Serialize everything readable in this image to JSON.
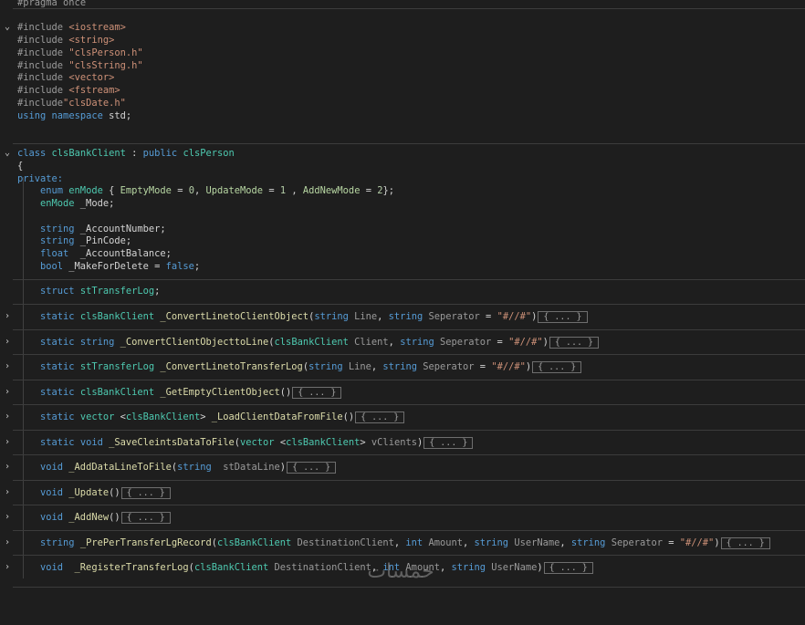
{
  "editor": {
    "lines": {
      "pragma": "#pragma once",
      "inc1_dir": "#include ",
      "inc1_file": "<iostream>",
      "inc2_dir": "#include ",
      "inc2_file": "<string>",
      "inc3_dir": "#include ",
      "inc3_file": "\"clsPerson.h\"",
      "inc4_dir": "#include ",
      "inc4_file": "\"clsString.h\"",
      "inc5_dir": "#include ",
      "inc5_file": "<vector>",
      "inc6_dir": "#include ",
      "inc6_file": "<fstream>",
      "inc7_dir": "#include",
      "inc7_file": "\"clsDate.h\"",
      "using_kw1": "using",
      "using_kw2": "namespace",
      "using_std": " std;",
      "class_kw": "class",
      "class_name": "clsBankClient",
      "class_sep": " : ",
      "class_pub": "public",
      "class_base": "clsPerson",
      "brace_open": "{",
      "private_kw": "private:",
      "enum_kw": "enum",
      "enum_name": "enMode",
      "enum_ob": " { ",
      "enum_v1": "EmptyMode",
      "enum_eq1": " = ",
      "enum_n1": "0",
      "enum_c1": ", ",
      "enum_v2": "UpdateMode",
      "enum_eq2": " = ",
      "enum_n2": "1",
      "enum_c2": " , ",
      "enum_v3": "AddNewMode",
      "enum_eq3": " = ",
      "enum_n3": "2",
      "enum_cb": "};",
      "mode_type": "enMode",
      "mode_var": " _Mode;",
      "acc_type": "string",
      "acc_var": " _AccountNumber;",
      "pin_type": "string",
      "pin_var": " _PinCode;",
      "bal_type": "float",
      "bal_var": "  _AccountBalance;",
      "del_type": "bool",
      "del_var": " _MakeForDelete = ",
      "del_val": "false",
      "del_end": ";",
      "struct_kw": "struct",
      "struct_name": "stTransferLog",
      "struct_end": ";",
      "f1_kw": "static",
      "f1_ret": "clsBankClient",
      "f1_name": "_ConvertLinetoClientObject",
      "f1_a": "(",
      "f1_t1": "string",
      "f1_p1": " Line",
      "f1_cm": ", ",
      "f1_t2": "string",
      "f1_p2": " Seperator",
      "f1_eq": " = ",
      "f1_def": "\"#//#\"",
      "f1_z": ")",
      "f2_kw": "static",
      "f2_ret": "string",
      "f2_name": "_ConvertClientObjecttoLine",
      "f2_a": "(",
      "f2_t1": "clsBankClient",
      "f2_p1": " Client",
      "f2_cm": ", ",
      "f2_t2": "string",
      "f2_p2": " Seperator",
      "f2_eq": " = ",
      "f2_def": "\"#//#\"",
      "f2_z": ")",
      "f3_kw": "static",
      "f3_ret": "stTransferLog",
      "f3_name": "_ConvertLinetoTransferLog",
      "f3_a": "(",
      "f3_t1": "string",
      "f3_p1": " Line",
      "f3_cm": ", ",
      "f3_t2": "string",
      "f3_p2": " Seperator",
      "f3_eq": " = ",
      "f3_def": "\"#//#\"",
      "f3_z": ")",
      "f4_kw": "static",
      "f4_ret": "clsBankClient",
      "f4_name": "_GetEmptyClientObject",
      "f4_z": "()",
      "f5_kw": "static",
      "f5_ret": "vector",
      "f5_lt": " <",
      "f5_tt": "clsBankClient",
      "f5_gt": "> ",
      "f5_name": "_LoadClientDataFromFile",
      "f5_z": "()",
      "f6_kw": "static",
      "f6_ret": "void",
      "f6_name": "_SaveCleintsDataToFile",
      "f6_a": "(",
      "f6_t1": "vector",
      "f6_lt": " <",
      "f6_tt": "clsBankClient",
      "f6_gt": "> ",
      "f6_p1": "vClients",
      "f6_z": ")",
      "f7_ret": "void",
      "f7_name": "_AddDataLineToFile",
      "f7_a": "(",
      "f7_t1": "string",
      "f7_p1": "  stDataLine",
      "f7_z": ")",
      "f8_ret": "void",
      "f8_name": "_Update",
      "f8_z": "()",
      "f9_ret": "void",
      "f9_name": "_AddNew",
      "f9_z": "()",
      "f10_ret": "string",
      "f10_name": "_PrePerTransferLgRecord",
      "f10_a": "(",
      "f10_t1": "clsBankClient",
      "f10_p1": " DestinationClient",
      "f10_c1": ", ",
      "f10_t2": "int",
      "f10_p2": " Amount",
      "f10_c2": ", ",
      "f10_t3": "string",
      "f10_p3": " UserName",
      "f10_c3": ", ",
      "f10_t4": "string",
      "f10_p4": " Seperator",
      "f10_eq": " = ",
      "f10_def": "\"#//#\"",
      "f10_z": ")",
      "f11_ret": "void",
      "f11_name": "_RegisterTransferLog",
      "f11_a": "(",
      "f11_t1": "clsBankClient",
      "f11_p1": " DestinationClient",
      "f11_c1": ", ",
      "f11_t2": "int",
      "f11_p2": " Amount",
      "f11_c2": ", ",
      "f11_t3": "string",
      "f11_p3": " UserName",
      "f11_z": ")"
    },
    "fold_marker": "{ ... }",
    "fold_icon_open": "⌄",
    "fold_icon_closed": "›"
  },
  "watermark": "خمسات",
  "colors": {
    "background": "#1e1e1e",
    "keyword": "#569cd6",
    "string": "#ce9178",
    "type": "#4ec9b0",
    "function": "#dcdcaa",
    "number": "#b5cea8",
    "preprocessor": "#9b9b9b"
  }
}
